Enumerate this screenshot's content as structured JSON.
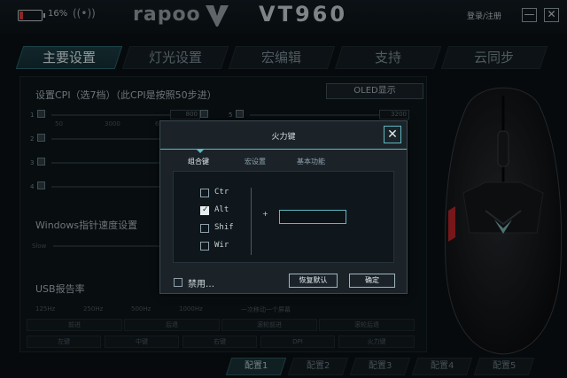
{
  "topbar": {
    "battery_text": "16%",
    "logo": "rapoo",
    "model": "VT960",
    "login": "登录/注册",
    "minimize": "—",
    "close": "✕"
  },
  "tabs": [
    "主要设置",
    "灯光设置",
    "宏编辑",
    "支持",
    "云同步"
  ],
  "panel": {
    "dpi_title": "设置CPI（选7档）（此CPI是按照50步进）",
    "oled_button": "OLED显示",
    "dpi_rows": [
      {
        "num": "1",
        "value": "800"
      },
      {
        "num": "2",
        "value": ""
      },
      {
        "num": "3",
        "value": ""
      },
      {
        "num": "4",
        "value": ""
      }
    ],
    "dpi_right": {
      "num": "5",
      "value": "3200"
    },
    "ticks": [
      "50",
      "3000",
      "6000"
    ],
    "pointer_title": "Windows指针速度设置",
    "pointer_low": "Slow",
    "usb_title": "USB报告率",
    "rates": [
      "125Hz",
      "250Hz",
      "500Hz",
      "1000Hz"
    ],
    "rate_extra": "一次移动一个屏幕",
    "row1": [
      "前进",
      "后退",
      "滚轮前进",
      "滚轮后退"
    ],
    "row2": [
      "左键",
      "中键",
      "右键",
      "DPI",
      "火力键"
    ]
  },
  "configs": [
    "配置1",
    "配置2",
    "配置3",
    "配置4",
    "配置5"
  ],
  "dialog": {
    "title": "火力键",
    "tabs": [
      "组合键",
      "宏设置",
      "基本功能"
    ],
    "modifiers": [
      {
        "label": "Ctr",
        "checked": false
      },
      {
        "label": "Alt",
        "checked": true
      },
      {
        "label": "Shif",
        "checked": false
      },
      {
        "label": "Wir",
        "checked": false
      }
    ],
    "plus": "+",
    "key_value": "",
    "disable_label": "禁用…",
    "reset_button": "恢复默认",
    "ok_button": "确定"
  },
  "colors": {
    "accent": "#5fb7c0",
    "background": "#0b1116",
    "warning": "#e04040"
  }
}
